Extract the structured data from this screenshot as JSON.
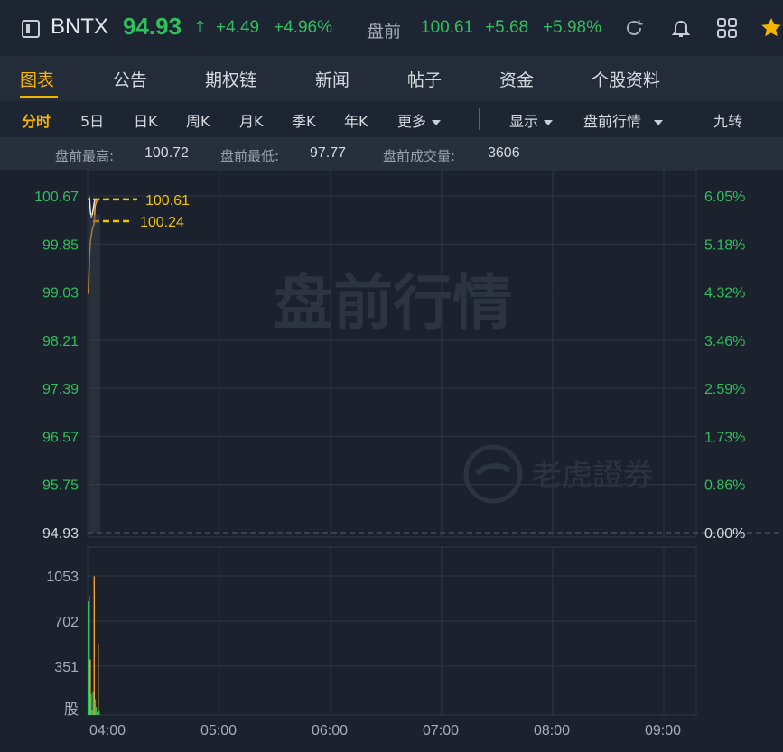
{
  "header": {
    "ticker": "BNTX",
    "price": "94.93",
    "arrow": "↑",
    "change": "+4.49",
    "change_pct": "+4.96%",
    "pre_label": "盘前",
    "pre_price": "100.61",
    "pre_change": "+5.68",
    "pre_pct": "+5.98%",
    "icons": [
      "refresh-icon",
      "bell-icon",
      "grid-icon",
      "star-icon"
    ]
  },
  "tabs": [
    {
      "label": "图表",
      "active": true
    },
    {
      "label": "公告"
    },
    {
      "label": "期权链"
    },
    {
      "label": "新闻"
    },
    {
      "label": "帖子"
    },
    {
      "label": "资金"
    },
    {
      "label": "个股资料"
    }
  ],
  "periods": {
    "items": [
      "分时",
      "5日",
      "日K",
      "周K",
      "月K",
      "季K",
      "年K"
    ],
    "more": "更多",
    "display": "显示",
    "premarket": "盘前行情",
    "nine": "九转"
  },
  "info": {
    "high_label": "盘前最高:",
    "high": "100.72",
    "low_label": "盘前最低:",
    "low": "97.77",
    "vol_label": "盘前成交量:",
    "vol": "3606"
  },
  "chart": {
    "watermark": "盘前行情",
    "brand": "老虎證券",
    "colors": {
      "up": "#2fbf5b",
      "line": "#f0a030",
      "ref": "#f5c400",
      "accent": "#f5b400"
    }
  },
  "chart_data": {
    "type": "line",
    "price_axis": {
      "ticks": [
        "100.67",
        "99.85",
        "99.03",
        "98.21",
        "97.39",
        "96.57",
        "95.75",
        "94.93"
      ],
      "range": [
        94.93,
        100.67
      ]
    },
    "pct_axis": {
      "ticks": [
        "6.05%",
        "5.18%",
        "4.32%",
        "3.46%",
        "2.59%",
        "1.73%",
        "0.86%",
        "0.00%"
      ]
    },
    "x_ticks": [
      "04:00",
      "05:00",
      "06:00",
      "07:00",
      "08:00",
      "09:00"
    ],
    "ref_lines": [
      {
        "label": "100.61",
        "value": 100.61
      },
      {
        "label": "100.24",
        "value": 100.24
      }
    ],
    "price_series": {
      "name": "",
      "x_minutes": [
        0,
        1,
        2,
        3,
        4,
        5,
        6,
        7,
        8,
        9,
        10,
        11,
        12
      ],
      "values": [
        99.0,
        99.6,
        99.9,
        100.0,
        100.1,
        100.15,
        100.2,
        100.5,
        100.55,
        100.6,
        100.62,
        100.61,
        100.61
      ]
    },
    "avg_series": {
      "x_minutes": [
        0,
        1,
        2,
        3,
        4,
        5,
        6,
        7
      ],
      "values": [
        100.6,
        100.65,
        100.4,
        100.3,
        100.35,
        100.45,
        100.55,
        100.61
      ]
    },
    "volume_axis": {
      "ticks": [
        "1053",
        "702",
        "351"
      ],
      "unit": "股",
      "max": 1053
    },
    "volume": {
      "x_minutes": [
        0,
        1,
        2,
        3,
        4,
        5,
        6,
        7,
        8,
        9,
        10,
        11
      ],
      "values": [
        860,
        900,
        420,
        160,
        40,
        180,
        1050,
        120,
        60,
        20,
        540,
        30
      ]
    }
  }
}
